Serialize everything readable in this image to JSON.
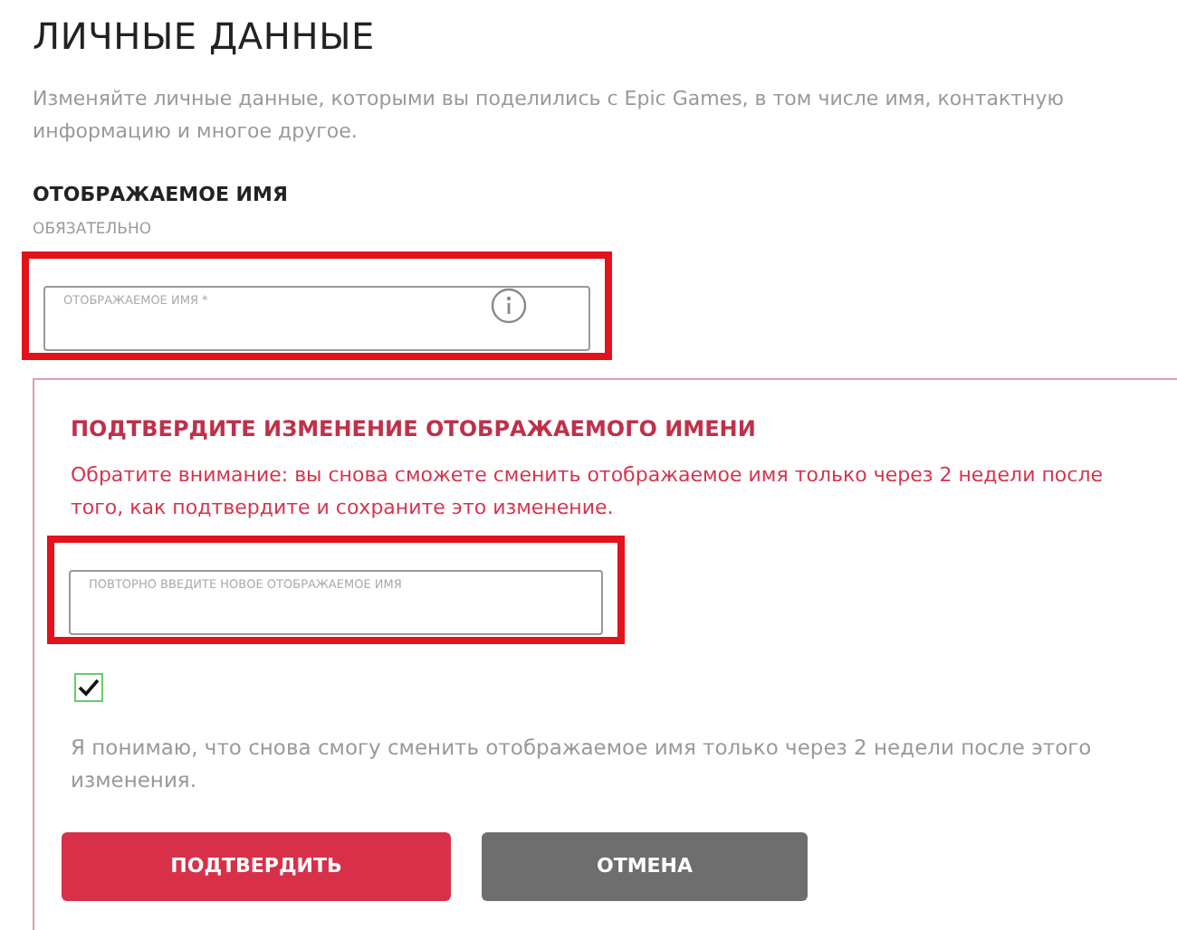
{
  "title": "ЛИЧНЫЕ ДАННЫЕ",
  "description": "Изменяйте личные данные, которыми вы поделились с Epic Games, в том числе имя, контактную информацию и многое другое.",
  "display_name": {
    "label": "ОТОБРАЖАЕМОЕ ИМЯ",
    "required_note": "ОБЯЗАТЕЛЬНО",
    "field": {
      "placeholder": "ОТОБРАЖАЕМОЕ ИМЯ *",
      "highlighted": true
    }
  },
  "confirm_panel": {
    "title": "ПОДТВЕРДИТЕ ИЗМЕНЕНИЕ ОТОБРАЖАЕМОГО ИМЕНИ",
    "warning": "Обратите внимание: вы снова сможете сменить отображаемое имя только через 2 недели после того, как подтвердите и сохраните это изменение.",
    "field": {
      "placeholder": "ПОВТОРНО ВВЕДИТЕ НОВОЕ ОТОБРАЖАЕМОЕ ИМЯ",
      "highlighted": true
    },
    "checkbox": {
      "checked": true,
      "label": "Я понимаю, что снова смогу сменить отображаемое имя только через 2 недели после этого изменения."
    },
    "buttons": [
      {
        "label": "ПОДТВЕРДИТЬ",
        "kind": "primary"
      },
      {
        "label": "ОТМЕНА",
        "kind": "secondary"
      }
    ]
  }
}
